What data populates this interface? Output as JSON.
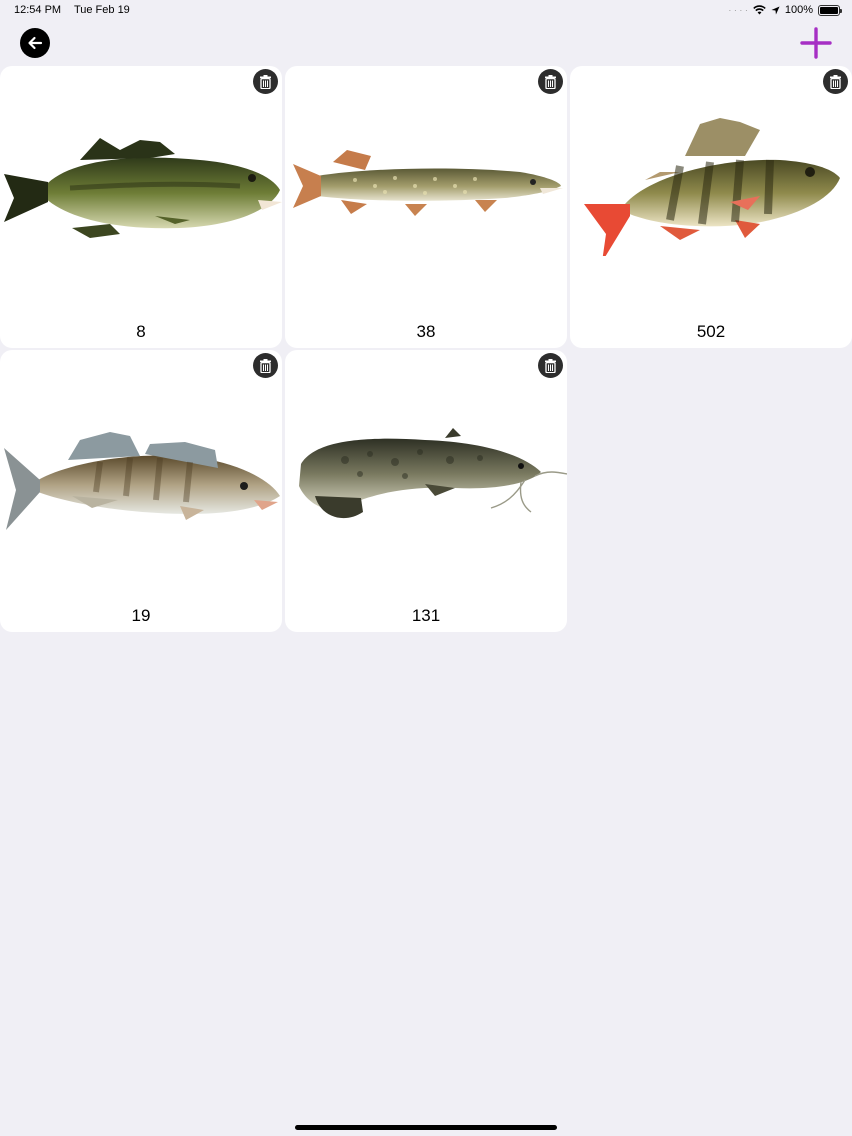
{
  "status": {
    "time": "12:54 PM",
    "date": "Tue Feb 19",
    "battery": "100%"
  },
  "nav": {
    "back_icon": "arrow-left-icon",
    "add_icon": "plus-icon",
    "accent": "#a62fc4"
  },
  "catches": [
    {
      "species_icon": "largemouth-bass",
      "count": "8"
    },
    {
      "species_icon": "northern-pike",
      "count": "38"
    },
    {
      "species_icon": "perch",
      "count": "502"
    },
    {
      "species_icon": "zander",
      "count": "19"
    },
    {
      "species_icon": "catfish",
      "count": "131"
    }
  ]
}
